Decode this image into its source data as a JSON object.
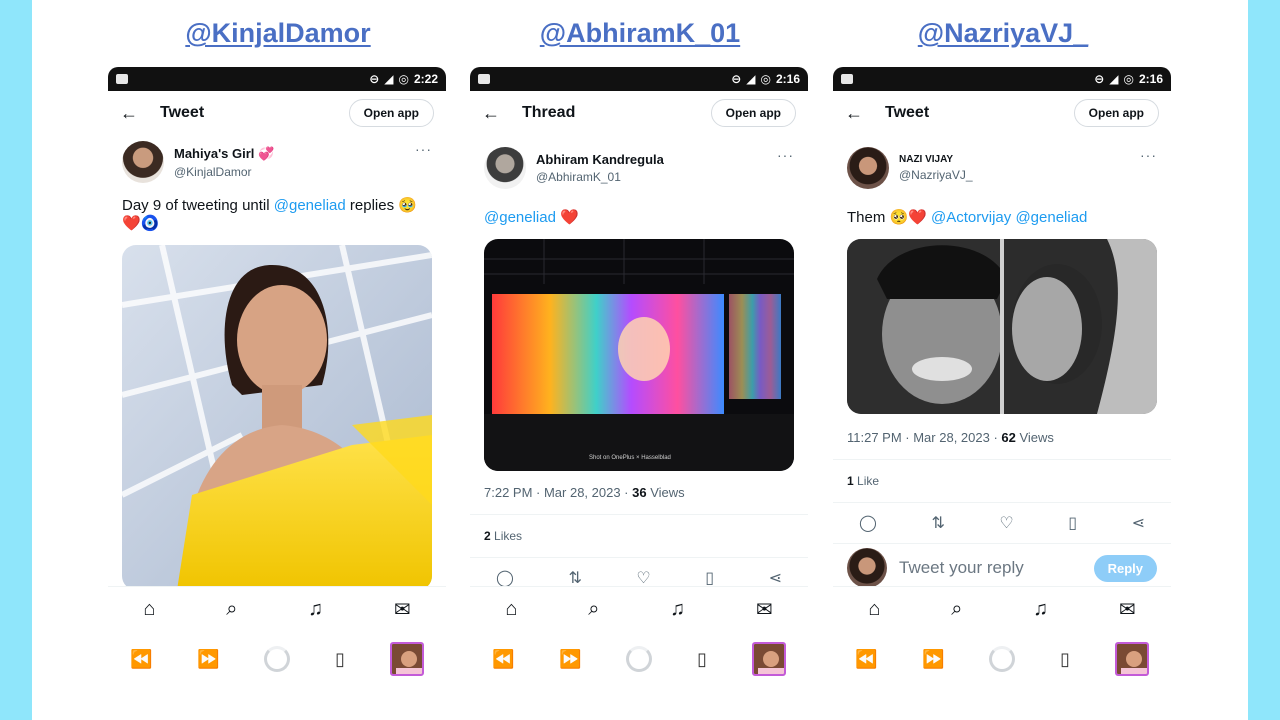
{
  "panels": [
    {
      "handle": "@KinjalDamor",
      "time": "2:22",
      "page_title": "Tweet",
      "open_app": "Open app",
      "author_name": "Mahiya's Girl 💞",
      "author_username": "@KinjalDamor",
      "tweet_prefix": "Day 9 of tweeting until ",
      "tweet_mention": "@geneliad",
      "tweet_suffix": " replies 🥹 ❤️🧿"
    },
    {
      "handle": "@AbhiramK_01",
      "time": "2:16",
      "page_title": "Thread",
      "open_app": "Open app",
      "author_name": "Abhiram Kandregula",
      "author_username": "@AbhiramK_01",
      "tweet_mention": "@geneliad",
      "tweet_suffix": " ❤️",
      "timestamp": "7:22 PM · Mar 28, 2023 · ",
      "views_count": "36",
      "views_label": " Views",
      "likes_count": "2",
      "likes_label": " Likes",
      "watermark": "Shot on OnePlus × Hasselblad"
    },
    {
      "handle": "@NazriyaVJ_",
      "time": "2:16",
      "page_title": "Tweet",
      "open_app": "Open app",
      "author_name": "NAZI VIJAY",
      "author_username": "@NazriyaVJ_",
      "tweet_prefix": "Them 🥺❤️ ",
      "tweet_mention": "@Actorvijay @geneliad",
      "timestamp": "11:27 PM · Mar 28, 2023 · ",
      "views_count": "62",
      "views_label": " Views",
      "likes_count": "1",
      "likes_label": " Like",
      "reply_placeholder": "Tweet your reply",
      "reply_button": "Reply"
    }
  ],
  "colors": {
    "background": "#8fe6fb",
    "handle": "#4a6fc4",
    "mention": "#1d9bf0"
  }
}
